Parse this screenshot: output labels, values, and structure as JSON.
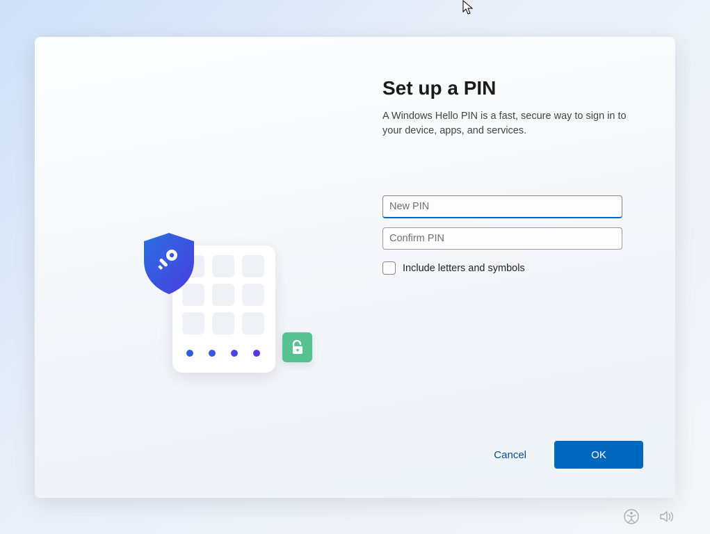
{
  "dialog": {
    "title": "Set up a PIN",
    "subtitle": "A Windows Hello PIN is a fast, secure way to sign in to your device, apps, and services.",
    "new_pin_placeholder": "New PIN",
    "confirm_pin_placeholder": "Confirm PIN",
    "checkbox_label": "Include letters and symbols",
    "cancel_label": "Cancel",
    "ok_label": "OK"
  },
  "icons": {
    "shield": "shield-key-icon",
    "unlock": "unlock-icon",
    "accessibility": "accessibility-icon",
    "volume": "volume-icon",
    "cursor": "cursor-arrow-icon"
  },
  "colors": {
    "primary": "#0067c0",
    "text_link": "#0a4d8c",
    "unlock_green": "#56c291"
  }
}
